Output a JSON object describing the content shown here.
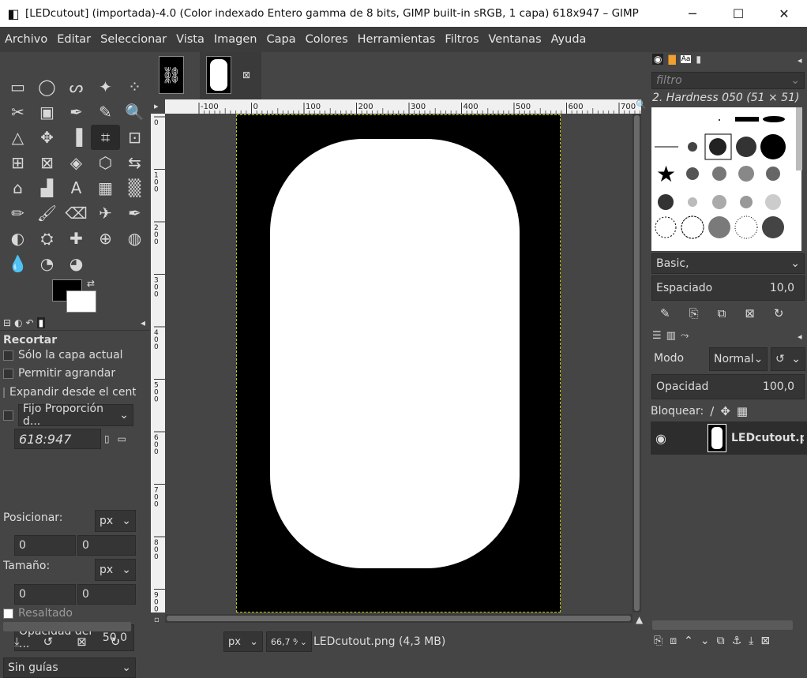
{
  "window": {
    "title": "[LEDcutout] (importada)-4.0 (Color indexado Entero gamma de 8 bits, GIMP built-in sRGB, 1 capa) 618x947 – GIMP",
    "minimize": "─",
    "maximize": "☐",
    "close": "✕"
  },
  "menu": [
    "Archivo",
    "Editar",
    "Seleccionar",
    "Vista",
    "Imagen",
    "Capa",
    "Colores",
    "Herramientas",
    "Filtros",
    "Ventanas",
    "Ayuda"
  ],
  "toolbox": {
    "icons": [
      "rect-select-icon",
      "ellipse-select-icon",
      "lasso-icon",
      "fuzzy-select-icon",
      "select-by-color-icon",
      "scissors-icon",
      "foreground-select-icon",
      "paths-icon",
      "color-picker-icon",
      "zoom-icon",
      "measure-icon",
      "move-icon",
      "align-icon",
      "crop-icon",
      "unified-transform-icon",
      "warp-icon",
      "handle-transform-icon",
      "perspective-icon",
      "3d-transform-icon",
      "flip-icon",
      "cage-icon",
      "bucket-fill-icon",
      "text-icon",
      "blend-icon",
      "gradient-icon",
      "pencil-icon",
      "paintbrush-icon",
      "eraser-icon",
      "airbrush-icon",
      "ink-icon",
      "mypaint-icon",
      "clone-icon",
      "heal-icon",
      "perspective-clone-icon",
      "smudge-icon",
      "blur-icon",
      "dodge-icon",
      "sharpen-icon"
    ],
    "glyphs": [
      "▭",
      "◯",
      "ᔕ",
      "✦",
      "⁘",
      "✂",
      "▣",
      "✒",
      "✎",
      "🔍",
      "△",
      "✥",
      "▐",
      "⌗",
      "⊡",
      "⊞",
      "⊠",
      "◈",
      "⬡",
      "⇆",
      "⌂",
      "▟",
      "A",
      "▦",
      "▒",
      "✏",
      "🖌",
      "⌫",
      "✈",
      "✒",
      "◐",
      "⛭",
      "✚",
      "⊕",
      "◍",
      "💧",
      "◔",
      "◕"
    ],
    "selected_index": 13
  },
  "tool_options": {
    "title": "Recortar",
    "current_layer_only": "Sólo la capa actual",
    "allow_growing": "Permitir agrandar",
    "expand_center": "Expandir desde el centro",
    "fixed_label": "Fijo Proporción d...",
    "ratio": "618:947",
    "position_label": "Posicionar:",
    "unit": "px",
    "pos_x": "0",
    "pos_y": "0",
    "size_label": "Tamaño:",
    "size_x": "0",
    "size_y": "0",
    "highlight": "Resaltado",
    "opacity_label": "Opacidad del ...",
    "opacity_value": "50,0",
    "guides": "Sin guías"
  },
  "canvas": {
    "ruler_ticks": [
      "-100",
      "0",
      "100",
      "200",
      "300",
      "400",
      "500",
      "600",
      "700"
    ],
    "vruler_ticks": [
      "0",
      "100",
      "200",
      "300",
      "400",
      "500",
      "600",
      "700",
      "800",
      "900"
    ],
    "unit": "px",
    "zoom": "66,7 %",
    "status": "LEDcutout.png (4,3 MB)"
  },
  "brushes": {
    "filter_placeholder": "filtro",
    "brush_name": "2. Hardness 050 (51 × 51)",
    "tag": "Basic,",
    "spacing_label": "Espaciado",
    "spacing_value": "10,0"
  },
  "layers": {
    "mode_label": "Modo",
    "mode_value": "Normal",
    "opacity_label": "Opacidad",
    "opacity_value": "100,0",
    "lock_label": "Bloquear:",
    "layer_name": "LEDcutout.png"
  }
}
